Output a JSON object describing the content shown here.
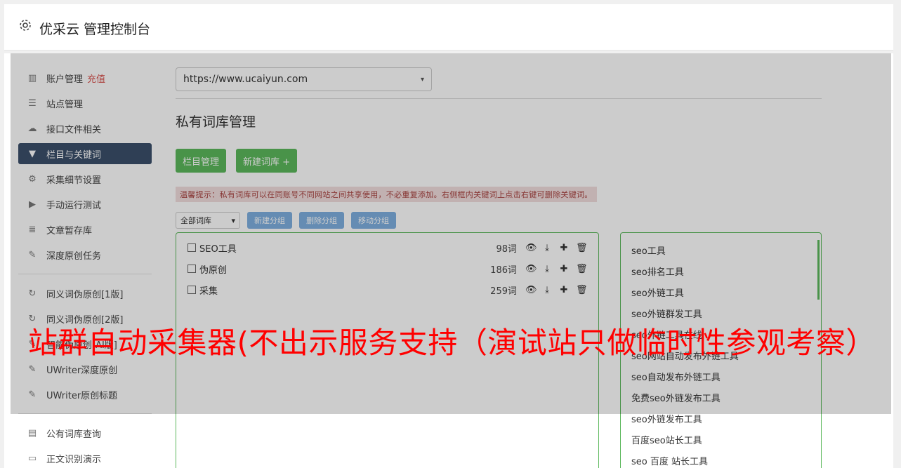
{
  "header": {
    "title": "优采云 管理控制台",
    "icon": "gear-icon"
  },
  "sidebar": {
    "group1": [
      {
        "label": "账户管理",
        "extra": "充值",
        "icon": "chart-icon"
      },
      {
        "label": "站点管理",
        "icon": "server-icon"
      },
      {
        "label": "接口文件相关",
        "icon": "cloud-upload-icon"
      },
      {
        "label": "栏目与关键词",
        "icon": "filter-icon",
        "active": true
      },
      {
        "label": "采集细节设置",
        "icon": "cogs-icon"
      },
      {
        "label": "手动运行测试",
        "icon": "play-icon"
      },
      {
        "label": "文章暂存库",
        "icon": "database-icon"
      },
      {
        "label": "深度原创任务",
        "icon": "edit-icon"
      }
    ],
    "group2": [
      {
        "label": "同义词伪原创[1版]",
        "icon": "refresh-icon"
      },
      {
        "label": "同义词伪原创[2版]",
        "icon": "refresh-icon"
      },
      {
        "label": "智能伪原创[AI版]",
        "icon": "edit-icon"
      },
      {
        "label": "UWriter深度原创",
        "icon": "edit-icon"
      },
      {
        "label": "UWriter原创标题",
        "icon": "edit-icon"
      }
    ],
    "group3": [
      {
        "label": "公有词库查询",
        "icon": "book-icon"
      },
      {
        "label": "正文识别演示",
        "icon": "monitor-icon"
      }
    ]
  },
  "main": {
    "site_select": "https://www.ucaiyun.com",
    "section_title": "私有词库管理",
    "btn_column": "栏目管理",
    "btn_new_lib": "新建词库 +",
    "tip": "温馨提示：私有词库可以在同账号不同网站之间共享使用，不必重复添加。右侧框内关键词上点击右键可删除关键词。",
    "group_select": "全部词库",
    "btn_new_group": "新建分组",
    "btn_del_group": "删除分组",
    "btn_move_group": "移动分组",
    "libraries": [
      {
        "name": "SEO工具",
        "count": "98词"
      },
      {
        "name": "伪原创",
        "count": "186词"
      },
      {
        "name": "采集",
        "count": "259词"
      }
    ],
    "keywords": [
      "seo工具",
      "seo排名工具",
      "seo外链工具",
      "seo外链群发工具",
      "seo外链工具在线",
      "seo网站自动发布外链工具",
      "seo自动发布外链工具",
      "免费seo外链发布工具",
      "seo外链发布工具",
      "百度seo站长工具",
      "seo 百度 站长工具"
    ]
  },
  "watermark": "站群自动采集器(不出示服务支持（演试站只做临时性参观考察）"
}
